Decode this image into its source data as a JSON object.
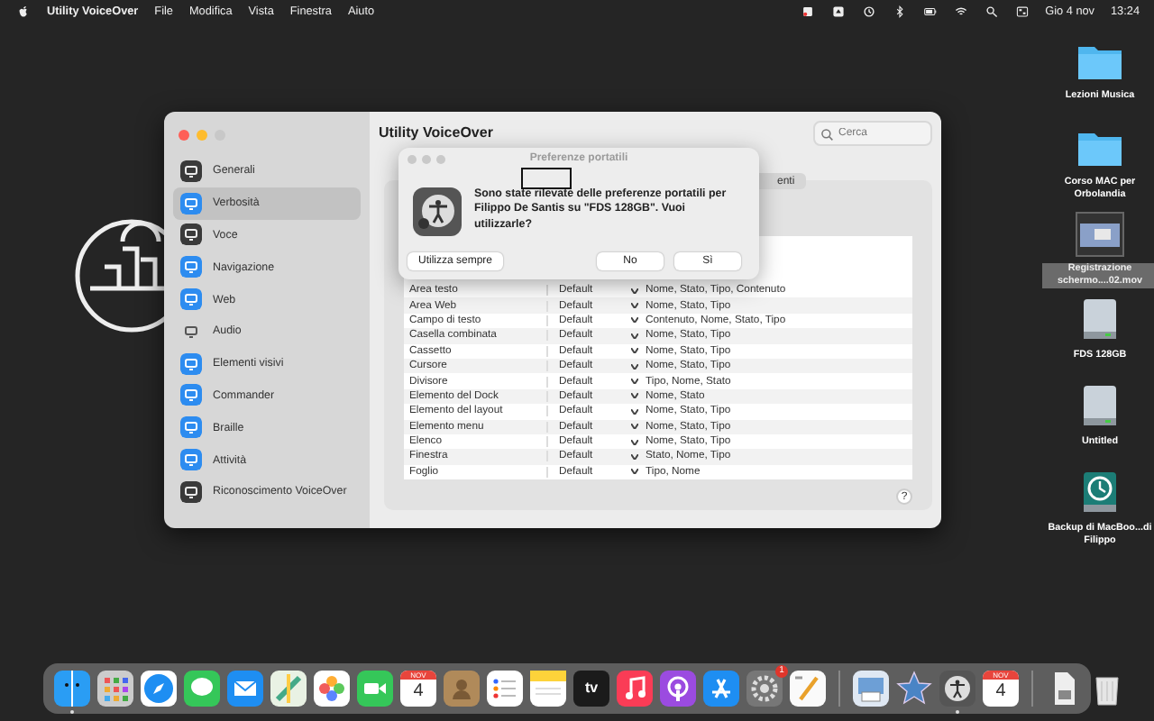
{
  "menu_bar": {
    "app": "Utility VoiceOver",
    "menus": [
      "File",
      "Modifica",
      "Vista",
      "Finestra",
      "Aiuto"
    ],
    "date": "Gio 4 nov",
    "time": "13:24"
  },
  "desktop_icons": [
    {
      "label": "Lezioni Musica",
      "kind": "folder",
      "selected": false
    },
    {
      "label": "Corso MAC per Orbolandia",
      "kind": "folder",
      "selected": false
    },
    {
      "label": "Registrazione schermo....02.mov",
      "kind": "video",
      "selected": true
    },
    {
      "label": "FDS 128GB",
      "kind": "drive",
      "selected": false
    },
    {
      "label": "Untitled",
      "kind": "drive",
      "selected": false
    },
    {
      "label": "Backup di MacBoo...di Filippo",
      "kind": "backup",
      "selected": false
    }
  ],
  "window": {
    "title": "Utility VoiceOver",
    "search": {
      "placeholder": "Cerca"
    },
    "sidebar": [
      {
        "label": "Generali",
        "kind": "dark",
        "selected": false
      },
      {
        "label": "Verbosità",
        "kind": "blue",
        "selected": true
      },
      {
        "label": "Voce",
        "kind": "dark",
        "selected": false
      },
      {
        "label": "Navigazione",
        "kind": "blue",
        "selected": false
      },
      {
        "label": "Web",
        "kind": "blue",
        "selected": false
      },
      {
        "label": "Audio",
        "kind": "bare",
        "selected": false
      },
      {
        "label": "Elementi visivi",
        "kind": "blue",
        "selected": false
      },
      {
        "label": "Commander",
        "kind": "blue",
        "selected": false
      },
      {
        "label": "Braille",
        "kind": "blue",
        "selected": false
      },
      {
        "label": "Attività",
        "kind": "blue",
        "selected": false
      },
      {
        "label": "Riconoscimento VoiceOver",
        "kind": "dark",
        "selected": false
      }
    ],
    "tab_fragment": "enti",
    "table": {
      "rows": [
        [
          "Area testo",
          "Default",
          "Nome, Stato, Tipo, Contenuto"
        ],
        [
          "Area Web",
          "Default",
          "Nome, Stato, Tipo"
        ],
        [
          "Campo di testo",
          "Default",
          "Contenuto, Nome, Stato, Tipo"
        ],
        [
          "Casella combinata",
          "Default",
          "Nome, Stato, Tipo"
        ],
        [
          "Cassetto",
          "Default",
          "Nome, Stato, Tipo"
        ],
        [
          "Cursore",
          "Default",
          "Nome, Stato, Tipo"
        ],
        [
          "Divisore",
          "Default",
          "Tipo, Nome, Stato"
        ],
        [
          "Elemento del Dock",
          "Default",
          "Nome, Stato"
        ],
        [
          "Elemento del layout",
          "Default",
          "Nome, Stato, Tipo"
        ],
        [
          "Elemento menu",
          "Default",
          "Nome, Stato, Tipo"
        ],
        [
          "Elenco",
          "Default",
          "Nome, Stato, Tipo"
        ],
        [
          "Finestra",
          "Default",
          "Stato, Nome, Tipo"
        ],
        [
          "Foglio",
          "Default",
          "Tipo, Nome"
        ]
      ]
    },
    "help": "?"
  },
  "dialog": {
    "title": "Preferenze portatili",
    "message": "Sono state rilevate delle preferenze portatili per Filippo De Santis su \"FDS 128GB\". Vuoi utilizzarle?",
    "buttons": [
      {
        "label": "Utilizza sempre",
        "kind": "left"
      },
      {
        "label": "No",
        "kind": "right"
      },
      {
        "label": "Sì",
        "kind": "right"
      }
    ]
  },
  "dock": [
    {
      "kind": "finder",
      "running": true
    },
    {
      "kind": "launchpad",
      "running": false
    },
    {
      "kind": "safari",
      "running": false
    },
    {
      "kind": "messages",
      "running": false
    },
    {
      "kind": "mail",
      "running": false
    },
    {
      "kind": "maps",
      "running": false
    },
    {
      "kind": "photos",
      "running": false
    },
    {
      "kind": "facetime",
      "running": false
    },
    {
      "kind": "calendar",
      "month": "NOV",
      "day": "4",
      "running": false
    },
    {
      "kind": "contacts",
      "running": false
    },
    {
      "kind": "reminders",
      "running": false
    },
    {
      "kind": "notes",
      "running": false
    },
    {
      "kind": "tv",
      "text": "tv",
      "running": false
    },
    {
      "kind": "music",
      "running": false
    },
    {
      "kind": "podcasts",
      "running": false
    },
    {
      "kind": "appstore",
      "running": false
    },
    {
      "kind": "settings",
      "badge": "1",
      "running": false
    },
    {
      "kind": "pen",
      "running": false
    },
    {
      "kind": "separator"
    },
    {
      "kind": "preview",
      "running": false
    },
    {
      "kind": "star",
      "running": false
    },
    {
      "kind": "voiceover",
      "running": true
    },
    {
      "kind": "calendar",
      "month": "NOV",
      "day": "4",
      "running": false
    },
    {
      "kind": "separator"
    },
    {
      "kind": "document",
      "running": false
    },
    {
      "kind": "trash",
      "running": false
    }
  ]
}
